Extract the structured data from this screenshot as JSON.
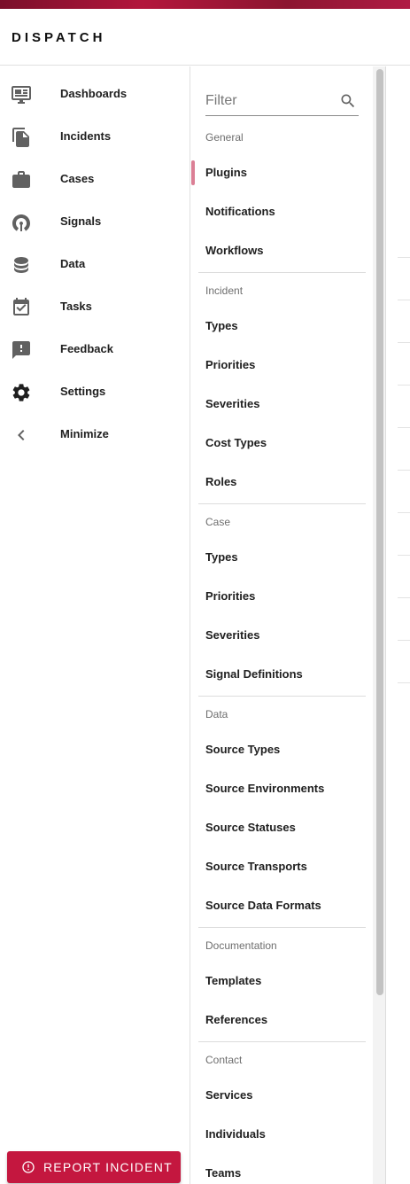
{
  "app": {
    "title": "DISPATCH"
  },
  "nav": {
    "items": [
      {
        "label": "Dashboards",
        "icon": "dashboard-icon"
      },
      {
        "label": "Incidents",
        "icon": "document-icon"
      },
      {
        "label": "Cases",
        "icon": "briefcase-icon"
      },
      {
        "label": "Signals",
        "icon": "signal-icon"
      },
      {
        "label": "Data",
        "icon": "database-icon"
      },
      {
        "label": "Tasks",
        "icon": "calendar-check-icon"
      },
      {
        "label": "Feedback",
        "icon": "feedback-icon"
      },
      {
        "label": "Settings",
        "icon": "gear-icon"
      },
      {
        "label": "Minimize",
        "icon": "chevron-left-icon"
      }
    ],
    "report_button": "REPORT INCIDENT"
  },
  "settings": {
    "filter_placeholder": "Filter",
    "active_item": "Plugins",
    "sections": [
      {
        "title": "General",
        "items": [
          "Plugins",
          "Notifications",
          "Workflows"
        ]
      },
      {
        "title": "Incident",
        "items": [
          "Types",
          "Priorities",
          "Severities",
          "Cost Types",
          "Roles"
        ]
      },
      {
        "title": "Case",
        "items": [
          "Types",
          "Priorities",
          "Severities",
          "Signal Definitions"
        ]
      },
      {
        "title": "Data",
        "items": [
          "Source Types",
          "Source Environments",
          "Source Statuses",
          "Source Transports",
          "Source Data Formats"
        ]
      },
      {
        "title": "Documentation",
        "items": [
          "Templates",
          "References"
        ]
      },
      {
        "title": "Contact",
        "items": [
          "Services",
          "Individuals",
          "Teams"
        ]
      }
    ]
  },
  "colors": {
    "brand": "#c4173f",
    "active_indicator": "#db7f95",
    "icon_gray": "#616161"
  }
}
